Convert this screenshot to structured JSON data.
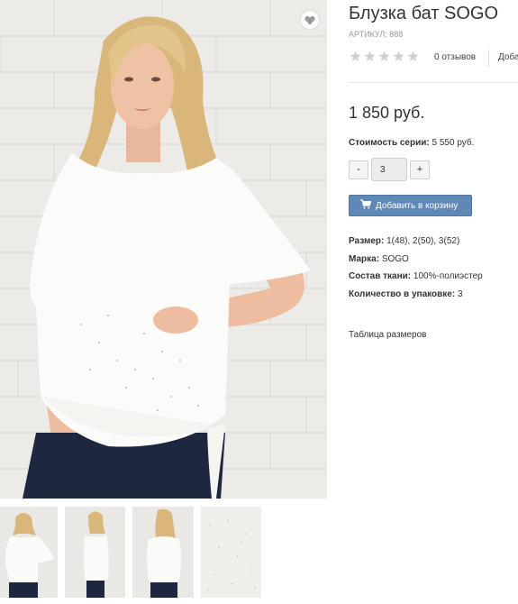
{
  "product": {
    "title": "Блузка бат SOGO",
    "sku_label": "Артикул:",
    "sku_value": "888",
    "rating": 0,
    "reviews_text": "0 отзывов",
    "add_review_text": "Доба",
    "price": "1 850 руб.",
    "series_label": "Стоимость серии:",
    "series_value": "5 550 руб.",
    "quantity": "3",
    "qty_minus": "-",
    "qty_plus": "+",
    "add_to_cart": "Добавить в корзину",
    "size_table_link": "Таблица размеров"
  },
  "properties": [
    {
      "label": "Размер:",
      "value": "1(48), 2(50), 3(52)"
    },
    {
      "label": "Марка:",
      "value": "SOGO"
    },
    {
      "label": "Состав ткани:",
      "value": "100%-полиэстер"
    },
    {
      "label": "Количество в упаковке:",
      "value": "3"
    }
  ],
  "icons": {
    "favorite": "heart-icon",
    "stars": "star-icon",
    "cart": "cart-icon"
  },
  "colors": {
    "button_bg": "#5f88b8",
    "star_empty": "#d0d0d0",
    "heart": "#999999"
  }
}
